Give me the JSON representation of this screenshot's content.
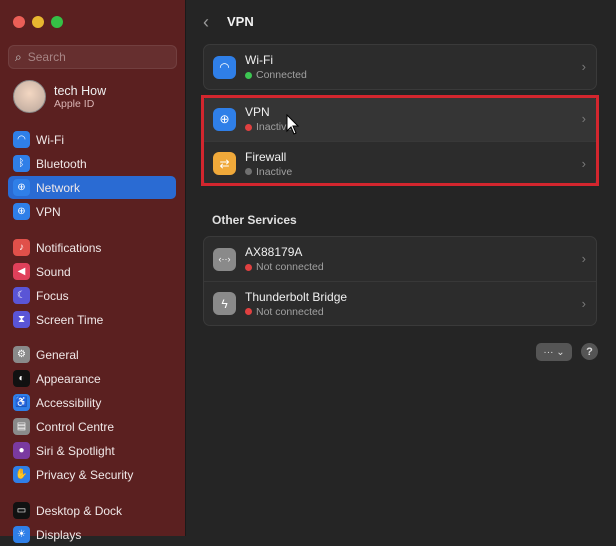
{
  "search": {
    "placeholder": "Search"
  },
  "user": {
    "name": "tech How",
    "subtitle": "Apple ID"
  },
  "sidebar": {
    "items": [
      {
        "label": "Wi-Fi",
        "icon": "wifi-icon",
        "color": "#2f7fe8"
      },
      {
        "label": "Bluetooth",
        "icon": "bluetooth-icon",
        "color": "#2f7fe8"
      },
      {
        "label": "Network",
        "icon": "globe-icon",
        "color": "#2f7fe8"
      },
      {
        "label": "VPN",
        "icon": "vpn-icon",
        "color": "#2f7fe8"
      },
      {
        "label": "Notifications",
        "icon": "bell-icon",
        "color": "#e0504a"
      },
      {
        "label": "Sound",
        "icon": "speaker-icon",
        "color": "#e0405a"
      },
      {
        "label": "Focus",
        "icon": "moon-icon",
        "color": "#5a55d6"
      },
      {
        "label": "Screen Time",
        "icon": "hourglass-icon",
        "color": "#5a55d6"
      },
      {
        "label": "General",
        "icon": "gear-icon",
        "color": "#8a8a8a"
      },
      {
        "label": "Appearance",
        "icon": "appearance-icon",
        "color": "#111111"
      },
      {
        "label": "Accessibility",
        "icon": "accessibility-icon",
        "color": "#2f7fe8"
      },
      {
        "label": "Control Centre",
        "icon": "control-centre-icon",
        "color": "#8a8a8a"
      },
      {
        "label": "Siri & Spotlight",
        "icon": "siri-icon",
        "color": "#7a3aa0"
      },
      {
        "label": "Privacy & Security",
        "icon": "hand-icon",
        "color": "#2f7fe8"
      },
      {
        "label": "Desktop & Dock",
        "icon": "dock-icon",
        "color": "#111111"
      },
      {
        "label": "Displays",
        "icon": "sun-icon",
        "color": "#2f7fe8"
      }
    ]
  },
  "main": {
    "title": "VPN",
    "wifi": {
      "title": "Wi-Fi",
      "status": "Connected",
      "status_color": "#3cc552"
    },
    "vpn": {
      "title": "VPN",
      "status": "Inactive",
      "status_color": "#e04040"
    },
    "firewall": {
      "title": "Firewall",
      "status": "Inactive",
      "status_color": "#707070"
    },
    "other_services_heading": "Other Services",
    "other": [
      {
        "title": "AX88179A",
        "status": "Not connected",
        "status_color": "#e04040"
      },
      {
        "title": "Thunderbolt Bridge",
        "status": "Not connected",
        "status_color": "#e04040"
      }
    ],
    "more_label": "··· ⌄",
    "help_label": "?"
  }
}
